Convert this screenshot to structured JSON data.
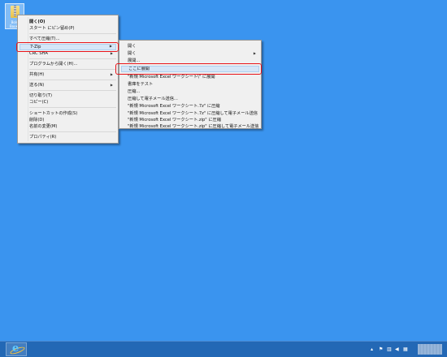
{
  "desktop": {
    "icon_caption_line1": "Bold",
    "icon_caption_line2": "Books"
  },
  "context_menu": {
    "items": [
      {
        "label": "開く(O)",
        "bold": true
      },
      {
        "label": "スタート にピン留め(P)"
      },
      {
        "label": "すべて圧縮(T)..."
      },
      {
        "label": "7-Zip",
        "submenu": true,
        "highlighted": true
      },
      {
        "label": "CRC SHA",
        "submenu": true
      },
      {
        "label": "プログラムから開く(H)..."
      },
      {
        "label": "共有(H)",
        "submenu": true
      },
      {
        "label": "送る(N)",
        "submenu": true
      },
      {
        "label": "切り取り(T)"
      },
      {
        "label": "コピー(C)"
      },
      {
        "label": "ショートカットの作成(S)"
      },
      {
        "label": "削除(D)"
      },
      {
        "label": "名前の変更(M)"
      },
      {
        "label": "プロパティ(R)"
      }
    ]
  },
  "submenu_7zip": {
    "items": [
      {
        "label": "開く"
      },
      {
        "label": "開く",
        "submenu": true
      },
      {
        "label": "展開..."
      },
      {
        "label": "ここに展開",
        "highlighted": true
      },
      {
        "label": "\"新規 Microsoft Excel ワークシート\\\" に展開"
      },
      {
        "label": "書庫をテスト"
      },
      {
        "label": "圧縮..."
      },
      {
        "label": "圧縮して電子メール送信..."
      },
      {
        "label": "\"新規 Microsoft Excel ワークシート.7z\" に圧縮"
      },
      {
        "label": "\"新規 Microsoft Excel ワークシート.7z\" に圧縮して電子メール送信"
      },
      {
        "label": "\"新規 Microsoft Excel ワークシート.zip\" に圧縮"
      },
      {
        "label": "\"新規 Microsoft Excel ワークシート.zip\" に圧縮して電子メール送信"
      }
    ]
  },
  "taskbar": {
    "pinned_app": "ie-icon",
    "tray_icons": [
      "up-arrow-icon",
      "flag-icon",
      "network-icon",
      "volume-icon",
      "ime-icon"
    ]
  },
  "colors": {
    "desktop": "#3a94ef",
    "taskbar": "#2368b5",
    "highlight_box": "#e8141a",
    "menu_bg": "#f0f0f0",
    "menu_highlight": "#d5e6f7"
  }
}
